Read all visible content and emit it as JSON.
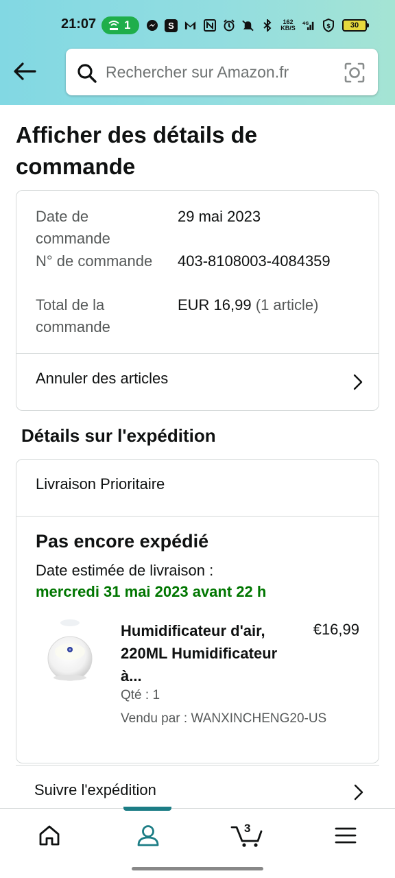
{
  "status_bar": {
    "time": "21:07",
    "hotspot_count": "1",
    "network_speed_value": "162",
    "network_speed_unit": "KB/S",
    "battery": "30"
  },
  "search": {
    "placeholder": "Rechercher sur Amazon.fr"
  },
  "page": {
    "title": "Afficher des détails de commande"
  },
  "order_summary": {
    "rows": [
      {
        "label": "Date de commande",
        "value": "29 mai 2023"
      },
      {
        "label": "N° de commande",
        "value": "403-8108003-4084359"
      },
      {
        "label": "Total de la commande",
        "value": "EUR 16,99",
        "value_suffix": "(1 article)"
      }
    ],
    "cancel_link": "Annuler des articles"
  },
  "shipment": {
    "section_title": "Détails sur l'expédition",
    "shipping_type": "Livraison Prioritaire",
    "status": "Pas encore expédié",
    "eta_label": "Date estimée de livraison :",
    "eta_value": "mercredi 31 mai 2023 avant 22 h",
    "product": {
      "name": "Humidificateur d'air, 220ML Humidificateur à...",
      "price": "€16,99",
      "qty": "Qté : 1",
      "seller": "Vendu par : WANXINCHENG20-US"
    },
    "track_link": "Suivre l'expédition"
  },
  "bottom_nav": {
    "items": [
      "home-icon",
      "account-icon",
      "cart-icon",
      "menu-icon"
    ],
    "active": "account-icon",
    "cart_count": "3"
  },
  "colors": {
    "header_gradient_start": "#82d8e3",
    "header_gradient_end": "#a5e4d4",
    "eta_green": "#007600",
    "active_nav": "#1c7d85"
  }
}
